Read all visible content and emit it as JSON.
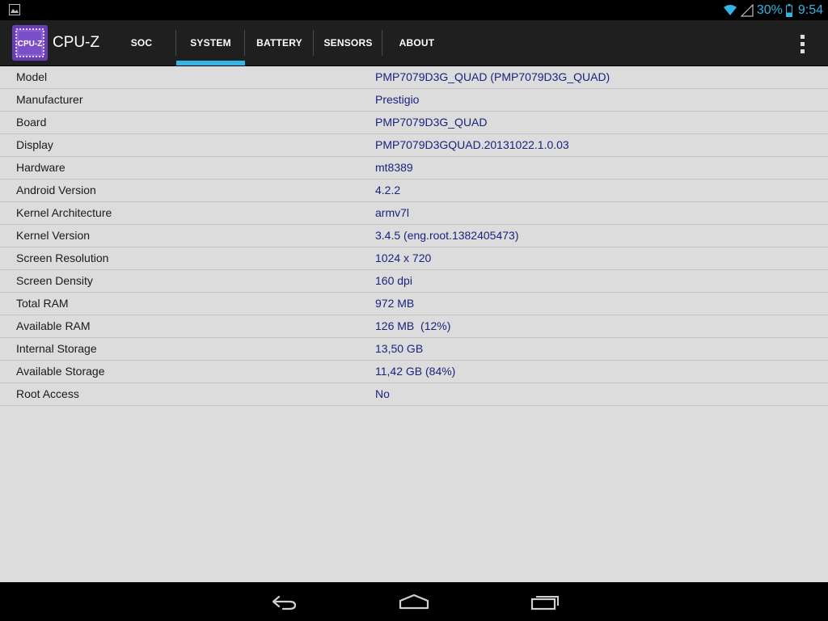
{
  "status_bar": {
    "battery_percent": "30%",
    "time": "9:54",
    "icons": [
      "image-notification-icon",
      "wifi-icon",
      "signal-icon",
      "battery-icon"
    ],
    "accent_color": "#33b5e5"
  },
  "app": {
    "title": "CPU-Z",
    "icon": "cpu-z-chip-icon",
    "icon_label": "CPU-Z"
  },
  "tabs": [
    {
      "label": "SOC",
      "active": false
    },
    {
      "label": "SYSTEM",
      "active": true
    },
    {
      "label": "BATTERY",
      "active": false
    },
    {
      "label": "SENSORS",
      "active": false
    },
    {
      "label": "ABOUT",
      "active": false
    }
  ],
  "system_info": [
    {
      "key": "Model",
      "value": "PMP7079D3G_QUAD (PMP7079D3G_QUAD)"
    },
    {
      "key": "Manufacturer",
      "value": "Prestigio"
    },
    {
      "key": "Board",
      "value": "PMP7079D3G_QUAD"
    },
    {
      "key": "Display",
      "value": "PMP7079D3GQUAD.20131022.1.0.03"
    },
    {
      "key": "Hardware",
      "value": "mt8389"
    },
    {
      "key": "Android Version",
      "value": "4.2.2"
    },
    {
      "key": "Kernel Architecture",
      "value": "armv7l"
    },
    {
      "key": "Kernel Version",
      "value": "3.4.5 (eng.root.1382405473)"
    },
    {
      "key": "Screen Resolution",
      "value": "1024 x 720"
    },
    {
      "key": "Screen Density",
      "value": "160 dpi"
    },
    {
      "key": "Total RAM",
      "value": "972 MB"
    },
    {
      "key": "Available RAM",
      "value": "126 MB  (12%)"
    },
    {
      "key": "Internal Storage",
      "value": "13,50 GB"
    },
    {
      "key": "Available Storage",
      "value": "11,42 GB (84%)"
    },
    {
      "key": "Root Access",
      "value": "No"
    }
  ],
  "nav_bar": {
    "icons": [
      "back-icon",
      "home-icon",
      "recent-apps-icon"
    ]
  }
}
